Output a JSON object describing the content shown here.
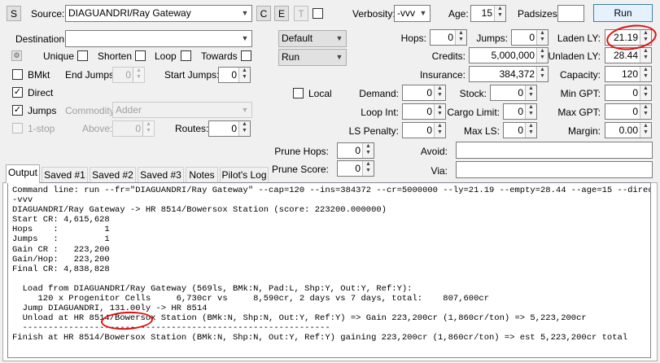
{
  "toolbar": {
    "s_button": "S",
    "source_label": "Source:",
    "source_value": "DIAGUANDRI/Ray Gateway",
    "c_button": "C",
    "e_button": "E",
    "t_button": "T",
    "verbosity_label": "Verbosity:",
    "verbosity_value": "-vvv",
    "age_label": "Age:",
    "age_value": "15",
    "padsizes_label": "Padsizes:",
    "padsizes_value": "",
    "run_button": "Run"
  },
  "left": {
    "destination_label": "Destination:",
    "destination_value": "",
    "unique_label": "Unique",
    "shorten_label": "Shorten",
    "loop_label": "Loop",
    "towards_label": "Towards",
    "bmkt_label": "BMkt",
    "end_jumps_label": "End Jumps:",
    "end_jumps_value": "0",
    "start_jumps_label": "Start Jumps:",
    "start_jumps_value": "0",
    "direct_label": "Direct",
    "jumps_label": "Jumps",
    "commodity_label": "Commodity:",
    "commodity_value": "Adder",
    "onestop_label": "1-stop",
    "above_label": "Above:",
    "above_value": "0",
    "routes_label": "Routes:",
    "routes_value": "0"
  },
  "middle": {
    "mode_value": "Default",
    "action_value": "Run",
    "local_label": "Local"
  },
  "params": {
    "hops_label": "Hops:",
    "hops_value": "0",
    "jumps_label": "Jumps:",
    "jumps_value": "0",
    "laden_label": "Laden LY:",
    "laden_value": "21.19",
    "credits_label": "Credits:",
    "credits_value": "5,000,000",
    "unladen_label": "Unladen LY:",
    "unladen_value": "28.44",
    "insurance_label": "Insurance:",
    "insurance_value": "384,372",
    "capacity_label": "Capacity:",
    "capacity_value": "120",
    "demand_label": "Demand:",
    "demand_value": "0",
    "stock_label": "Stock:",
    "stock_value": "0",
    "min_gpt_label": "Min GPT:",
    "min_gpt_value": "0",
    "loop_int_label": "Loop Int:",
    "loop_int_value": "0",
    "cargo_limit_label": "Cargo Limit:",
    "cargo_limit_value": "0",
    "max_gpt_label": "Max GPT:",
    "max_gpt_value": "0",
    "ls_penalty_label": "LS Penalty:",
    "ls_penalty_value": "0",
    "max_ls_label": "Max LS:",
    "max_ls_value": "0",
    "margin_label": "Margin:",
    "margin_value": "0.00",
    "prune_hops_label": "Prune Hops:",
    "prune_hops_value": "0",
    "prune_score_label": "Prune Score:",
    "prune_score_value": "0",
    "avoid_label": "Avoid:",
    "avoid_value": "",
    "via_label": "Via:",
    "via_value": ""
  },
  "tabs": [
    "Output",
    "Saved #1",
    "Saved #2",
    "Saved #3",
    "Notes",
    "Pilot's Log"
  ],
  "output_text": "Command line: run --fr=\"DIAGUANDRI/Ray Gateway\" --cap=120 --ins=384372 --cr=5000000 --ly=21.19 --empty=28.44 --age=15 --direct -J\n-vvv\nDIAGUANDRI/Ray Gateway -> HR 8514/Bowersox Station (score: 223200.000000)\nStart CR: 4,615,628\nHops    :         1\nJumps   :         1\nGain CR :   223,200\nGain/Hop:   223,200\nFinal CR: 4,838,828\n\n  Load from DIAGUANDRI/Ray Gateway (569ls, BMk:N, Pad:L, Shp:Y, Out:Y, Ref:Y):\n     120 x Progenitor Cells     6,730cr vs     8,590cr, 2 days vs 7 days, total:    807,600cr\n  Jump DIAGUANDRI, 131.00ly -> HR 8514\n  Unload at HR 8514/Bowersox Station (BMk:N, Shp:N, Out:Y, Ref:Y) => Gain 223,200cr (1,860cr/ton) => 5,223,200cr\n  ------------------------------------------------------------\nFinish at HR 8514/Bowersox Station (BMk:N, Shp:N, Out:Y, Ref:Y) gaining 223,200cr (1,860cr/ton) => est 5,223,200cr total",
  "colors": {
    "highlight_circle": "#e01010",
    "window_bg": "#f0f0f0"
  }
}
